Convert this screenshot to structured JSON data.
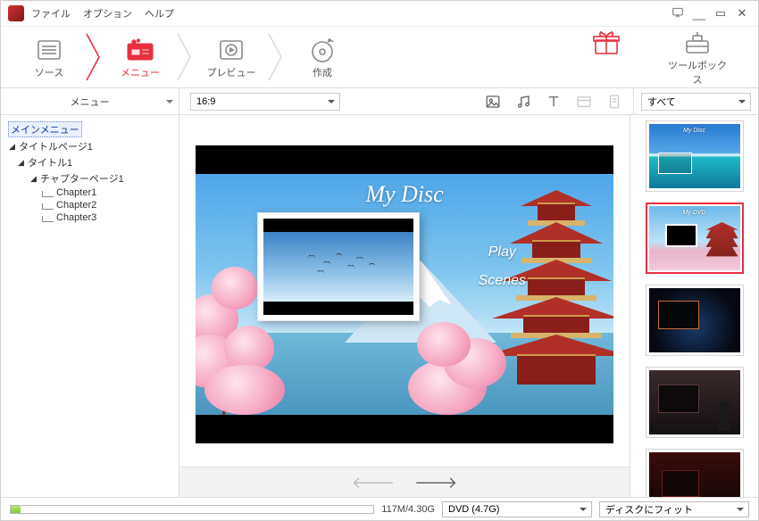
{
  "titlebar": {
    "file": "ファイル",
    "option": "オプション",
    "help": "ヘルプ"
  },
  "steps": {
    "source": "ソース",
    "menu": "メニュー",
    "preview": "プレビュー",
    "create": "作成",
    "toolbox": "ツールボックス"
  },
  "subbar": {
    "left_label": "メニュー",
    "aspect": "16:9",
    "filter": "すべて"
  },
  "tree": {
    "main_menu": "メインメニュー",
    "title_page": "タイトルページ1",
    "title": "タイトル1",
    "chapter_page": "チャプターページ1",
    "chapters": [
      "Chapter1",
      "Chapter2",
      "Chapter3"
    ]
  },
  "disc_menu": {
    "title": "My Disc",
    "play": "Play",
    "scenes": "Scenes"
  },
  "templates": [
    {
      "title": "My Disc"
    },
    {
      "title": "My DVD"
    },
    {
      "title": ""
    },
    {
      "title": ""
    },
    {
      "title": ""
    }
  ],
  "status": {
    "usage_text": "117M/4.30G",
    "usage_percent": 2.7,
    "disc_type": "DVD (4.7G)",
    "fit": "ディスクにフィット"
  }
}
